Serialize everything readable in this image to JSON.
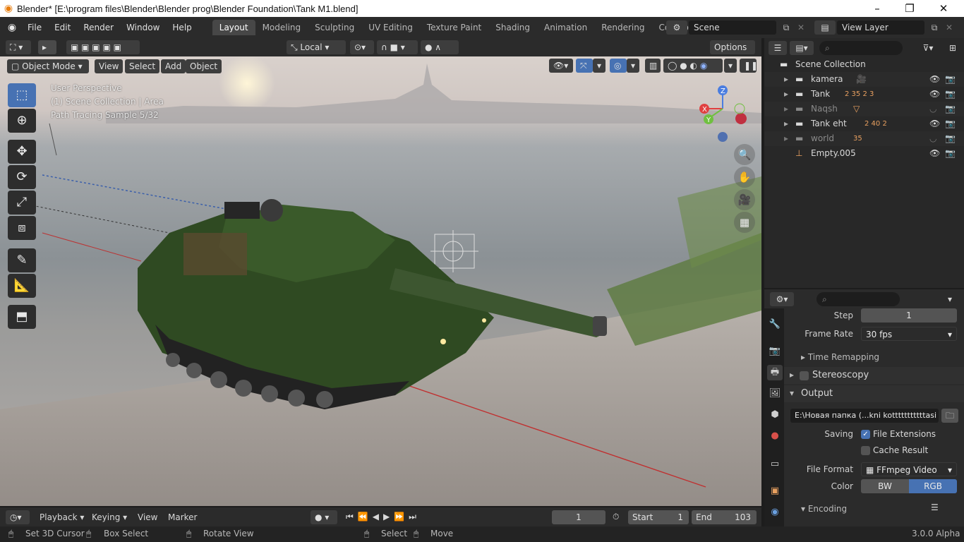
{
  "window": {
    "title": "Blender* [E:\\program files\\Blender\\Blender prog\\Blender Foundation\\Tank M1.blend]",
    "minimize": "–",
    "maximize": "❐",
    "close": "✕"
  },
  "menubar": {
    "items": [
      "File",
      "Edit",
      "Render",
      "Window",
      "Help"
    ],
    "workspaces": [
      "Layout",
      "Modeling",
      "Sculpting",
      "UV Editing",
      "Texture Paint",
      "Shading",
      "Animation",
      "Rendering",
      "Compositing"
    ],
    "scene": "Scene",
    "view_layer": "View Layer"
  },
  "viewport_header": {
    "transform_orientation": "Local",
    "options": "Options",
    "mode": "Object Mode",
    "menus": [
      "View",
      "Select",
      "Add",
      "Object"
    ]
  },
  "viewport": {
    "overlay_lines": [
      "User Perspective",
      "(1) Scene Collection | Area",
      "Path Tracing Sample 5/32"
    ],
    "gizmo_axes": {
      "x": "X",
      "y": "Y",
      "z": "Z"
    }
  },
  "outliner": {
    "search_placeholder": "",
    "root": "Scene Collection",
    "items": [
      {
        "name": "kamera",
        "badge": ""
      },
      {
        "name": "Tank",
        "badge": "2  35  2  3"
      },
      {
        "name": "Naqsh",
        "badge": ""
      },
      {
        "name": "Tank eht",
        "badge": "2  40  2"
      },
      {
        "name": "world",
        "badge": "35"
      },
      {
        "name": "Empty.005",
        "badge": ""
      }
    ]
  },
  "properties": {
    "step_label": "Step",
    "step_value": "1",
    "frame_rate_label": "Frame Rate",
    "frame_rate_value": "30 fps",
    "time_remapping": "Time Remapping",
    "stereoscopy": "Stereoscopy",
    "output": "Output",
    "output_path": "E:\\Новая папка (...kni kotttttttttttasi",
    "saving_label": "Saving",
    "file_extensions": "File Extensions",
    "cache_result": "Cache Result",
    "file_format_label": "File Format",
    "file_format_value": "FFmpeg Video",
    "color_label": "Color",
    "color_bw": "BW",
    "color_rgb": "RGB",
    "encoding": "Encoding"
  },
  "timeline": {
    "playback": "Playback",
    "keying": "Keying",
    "view": "View",
    "marker": "Marker",
    "current_frame": "1",
    "start_label": "Start",
    "start_value": "1",
    "end_label": "End",
    "end_value": "103"
  },
  "statusbar": {
    "set_cursor": "Set 3D Cursor",
    "box_select": "Box Select",
    "rotate_view": "Rotate View",
    "select": "Select",
    "move": "Move",
    "version": "3.0.0 Alpha"
  },
  "colors": {
    "accent": "#4772b3",
    "blender_orange": "#e87d0d",
    "tank_green": "#2f4a22"
  }
}
